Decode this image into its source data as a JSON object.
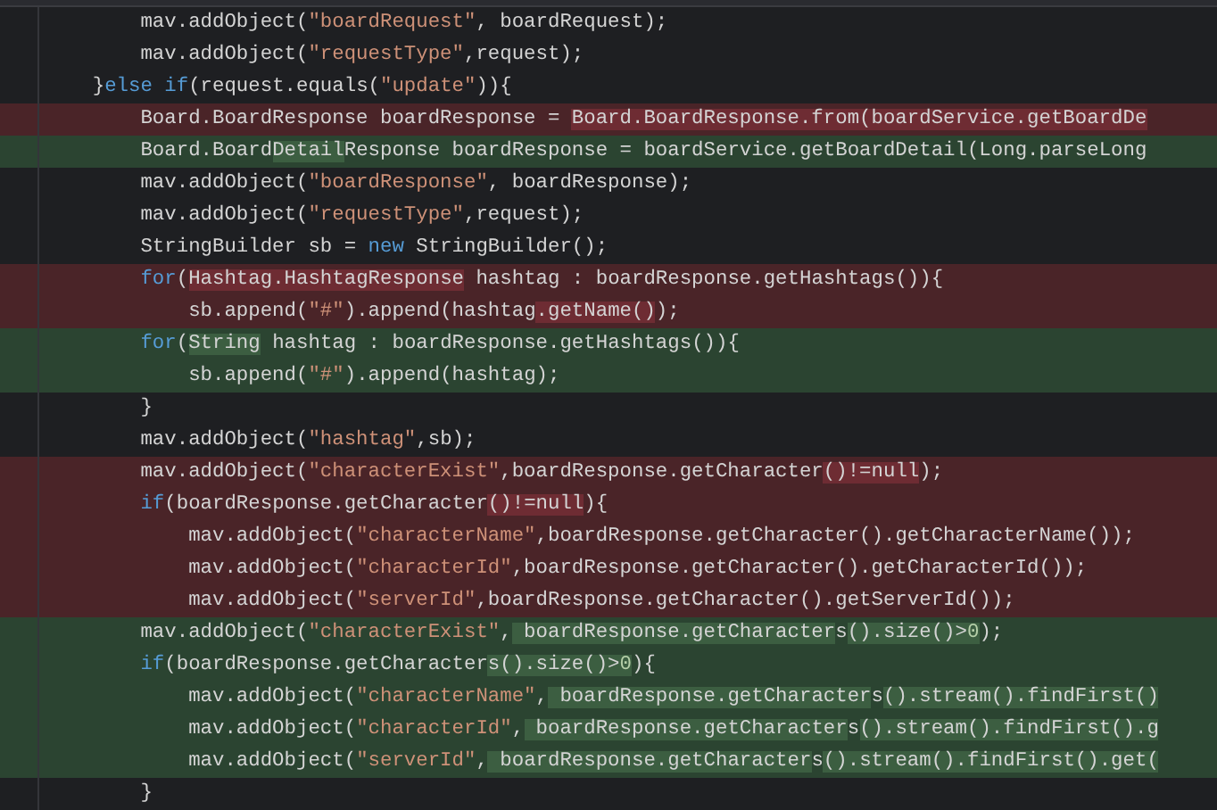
{
  "lines": [
    {
      "kind": "context",
      "segments": [
        {
          "text": "        mav.addObject(",
          "kind": "plain",
          "changed": false
        },
        {
          "text": "\"boardRequest\"",
          "kind": "string",
          "changed": false
        },
        {
          "text": ", boardRequest);",
          "kind": "plain",
          "changed": false
        }
      ]
    },
    {
      "kind": "context",
      "segments": [
        {
          "text": "        mav.addObject(",
          "kind": "plain",
          "changed": false
        },
        {
          "text": "\"requestType\"",
          "kind": "string",
          "changed": false
        },
        {
          "text": ",request);",
          "kind": "plain",
          "changed": false
        }
      ]
    },
    {
      "kind": "context",
      "segments": [
        {
          "text": "    }",
          "kind": "plain",
          "changed": false
        },
        {
          "text": "else if",
          "kind": "keyword",
          "changed": false
        },
        {
          "text": "(request.equals(",
          "kind": "plain",
          "changed": false
        },
        {
          "text": "\"update\"",
          "kind": "string",
          "changed": false
        },
        {
          "text": ")){",
          "kind": "plain",
          "changed": false
        }
      ]
    },
    {
      "kind": "removed",
      "segments": [
        {
          "text": "        Board.BoardResponse boardResponse = ",
          "kind": "plain",
          "changed": false
        },
        {
          "text": "Board.BoardResponse.from(boardService.getBoardDe",
          "kind": "plain",
          "changed": true
        }
      ]
    },
    {
      "kind": "added",
      "segments": [
        {
          "text": "        Board.Board",
          "kind": "plain",
          "changed": false
        },
        {
          "text": "Detail",
          "kind": "plain",
          "changed": true
        },
        {
          "text": "Response boardResponse = boardService.getBoardDetail(Long.parseLong",
          "kind": "plain",
          "changed": false
        }
      ]
    },
    {
      "kind": "context",
      "segments": [
        {
          "text": "        mav.addObject(",
          "kind": "plain",
          "changed": false
        },
        {
          "text": "\"boardResponse\"",
          "kind": "string",
          "changed": false
        },
        {
          "text": ", boardResponse);",
          "kind": "plain",
          "changed": false
        }
      ]
    },
    {
      "kind": "context",
      "segments": [
        {
          "text": "        mav.addObject(",
          "kind": "plain",
          "changed": false
        },
        {
          "text": "\"requestType\"",
          "kind": "string",
          "changed": false
        },
        {
          "text": ",request);",
          "kind": "plain",
          "changed": false
        }
      ]
    },
    {
      "kind": "context",
      "segments": [
        {
          "text": "        StringBuilder sb = ",
          "kind": "plain",
          "changed": false
        },
        {
          "text": "new",
          "kind": "keyword",
          "changed": false
        },
        {
          "text": " StringBuilder();",
          "kind": "plain",
          "changed": false
        }
      ]
    },
    {
      "kind": "removed",
      "segments": [
        {
          "text": "        for",
          "kind": "keyword",
          "changed": false
        },
        {
          "text": "(",
          "kind": "plain",
          "changed": false
        },
        {
          "text": "Hashtag.HashtagResponse",
          "kind": "plain",
          "changed": true
        },
        {
          "text": " hashtag : boardResponse.getHashtags()){",
          "kind": "plain",
          "changed": false
        }
      ]
    },
    {
      "kind": "removed",
      "segments": [
        {
          "text": "            sb.append(",
          "kind": "plain",
          "changed": false
        },
        {
          "text": "\"#\"",
          "kind": "string",
          "changed": false
        },
        {
          "text": ").append(hashtag",
          "kind": "plain",
          "changed": false
        },
        {
          "text": ".getName()",
          "kind": "plain",
          "changed": true
        },
        {
          "text": ");",
          "kind": "plain",
          "changed": false
        }
      ]
    },
    {
      "kind": "added",
      "segments": [
        {
          "text": "        for",
          "kind": "keyword",
          "changed": false
        },
        {
          "text": "(",
          "kind": "plain",
          "changed": false
        },
        {
          "text": "String",
          "kind": "plain",
          "changed": true
        },
        {
          "text": " hashtag : boardResponse.getHashtags()){",
          "kind": "plain",
          "changed": false
        }
      ]
    },
    {
      "kind": "added",
      "segments": [
        {
          "text": "            sb.append(",
          "kind": "plain",
          "changed": false
        },
        {
          "text": "\"#\"",
          "kind": "string",
          "changed": false
        },
        {
          "text": ").append(hashtag);",
          "kind": "plain",
          "changed": false
        }
      ]
    },
    {
      "kind": "context",
      "segments": [
        {
          "text": "        }",
          "kind": "plain",
          "changed": false
        }
      ]
    },
    {
      "kind": "context",
      "segments": [
        {
          "text": "        mav.addObject(",
          "kind": "plain",
          "changed": false
        },
        {
          "text": "\"hashtag\"",
          "kind": "string",
          "changed": false
        },
        {
          "text": ",sb);",
          "kind": "plain",
          "changed": false
        }
      ]
    },
    {
      "kind": "removed",
      "segments": [
        {
          "text": "        mav.addObject(",
          "kind": "plain",
          "changed": false
        },
        {
          "text": "\"characterExist\"",
          "kind": "string",
          "changed": false
        },
        {
          "text": ",boardResponse.getCharacter",
          "kind": "plain",
          "changed": false
        },
        {
          "text": "()!=null",
          "kind": "plain",
          "changed": true
        },
        {
          "text": ");",
          "kind": "plain",
          "changed": false
        }
      ]
    },
    {
      "kind": "removed",
      "segments": [
        {
          "text": "        if",
          "kind": "keyword",
          "changed": false
        },
        {
          "text": "(boardResponse.getCharacter",
          "kind": "plain",
          "changed": false
        },
        {
          "text": "()!=null",
          "kind": "plain",
          "changed": true
        },
        {
          "text": "){",
          "kind": "plain",
          "changed": false
        }
      ]
    },
    {
      "kind": "removed",
      "segments": [
        {
          "text": "            mav.addObject(",
          "kind": "plain",
          "changed": false
        },
        {
          "text": "\"characterName\"",
          "kind": "string",
          "changed": false
        },
        {
          "text": ",boardResponse.getCharacter().getCharacterName());",
          "kind": "plain",
          "changed": false
        }
      ]
    },
    {
      "kind": "removed",
      "segments": [
        {
          "text": "            mav.addObject(",
          "kind": "plain",
          "changed": false
        },
        {
          "text": "\"characterId\"",
          "kind": "string",
          "changed": false
        },
        {
          "text": ",boardResponse.getCharacter().getCharacterId());",
          "kind": "plain",
          "changed": false
        }
      ]
    },
    {
      "kind": "removed",
      "segments": [
        {
          "text": "            mav.addObject(",
          "kind": "plain",
          "changed": false
        },
        {
          "text": "\"serverId\"",
          "kind": "string",
          "changed": false
        },
        {
          "text": ",boardResponse.getCharacter().getServerId());",
          "kind": "plain",
          "changed": false
        }
      ]
    },
    {
      "kind": "added",
      "segments": [
        {
          "text": "        mav.addObject(",
          "kind": "plain",
          "changed": false
        },
        {
          "text": "\"characterExist\"",
          "kind": "string",
          "changed": false
        },
        {
          "text": ",",
          "kind": "plain",
          "changed": false
        },
        {
          "text": " boardResponse.getCharacter",
          "kind": "plain",
          "changed": true
        },
        {
          "text": "s",
          "kind": "plain",
          "changed": false
        },
        {
          "text": "().size()>",
          "kind": "plain",
          "changed": true
        },
        {
          "text": "0",
          "kind": "number",
          "changed": true
        },
        {
          "text": ");",
          "kind": "plain",
          "changed": false
        }
      ]
    },
    {
      "kind": "added",
      "segments": [
        {
          "text": "        if",
          "kind": "keyword",
          "changed": false
        },
        {
          "text": "(boardResponse.getCharacter",
          "kind": "plain",
          "changed": false
        },
        {
          "text": "s().size()>",
          "kind": "plain",
          "changed": true
        },
        {
          "text": "0",
          "kind": "number",
          "changed": true
        },
        {
          "text": "){",
          "kind": "plain",
          "changed": false
        }
      ]
    },
    {
      "kind": "added",
      "segments": [
        {
          "text": "            mav.addObject(",
          "kind": "plain",
          "changed": false
        },
        {
          "text": "\"characterName\"",
          "kind": "string",
          "changed": false
        },
        {
          "text": ",",
          "kind": "plain",
          "changed": false
        },
        {
          "text": " boardResponse.getCharacter",
          "kind": "plain",
          "changed": true
        },
        {
          "text": "s",
          "kind": "plain",
          "changed": false
        },
        {
          "text": "().stream().findFirst()",
          "kind": "plain",
          "changed": true
        }
      ]
    },
    {
      "kind": "added",
      "segments": [
        {
          "text": "            mav.addObject(",
          "kind": "plain",
          "changed": false
        },
        {
          "text": "\"characterId\"",
          "kind": "string",
          "changed": false
        },
        {
          "text": ",",
          "kind": "plain",
          "changed": false
        },
        {
          "text": " boardResponse.getCharacter",
          "kind": "plain",
          "changed": true
        },
        {
          "text": "s",
          "kind": "plain",
          "changed": false
        },
        {
          "text": "().stream().findFirst().g",
          "kind": "plain",
          "changed": true
        }
      ]
    },
    {
      "kind": "added",
      "segments": [
        {
          "text": "            mav.addObject(",
          "kind": "plain",
          "changed": false
        },
        {
          "text": "\"serverId\"",
          "kind": "string",
          "changed": false
        },
        {
          "text": ",",
          "kind": "plain",
          "changed": false
        },
        {
          "text": " boardResponse.getCharacter",
          "kind": "plain",
          "changed": true
        },
        {
          "text": "s",
          "kind": "plain",
          "changed": false
        },
        {
          "text": "().stream().findFirst().get(",
          "kind": "plain",
          "changed": true
        }
      ]
    },
    {
      "kind": "context",
      "segments": [
        {
          "text": "        }",
          "kind": "plain",
          "changed": false
        }
      ]
    }
  ]
}
